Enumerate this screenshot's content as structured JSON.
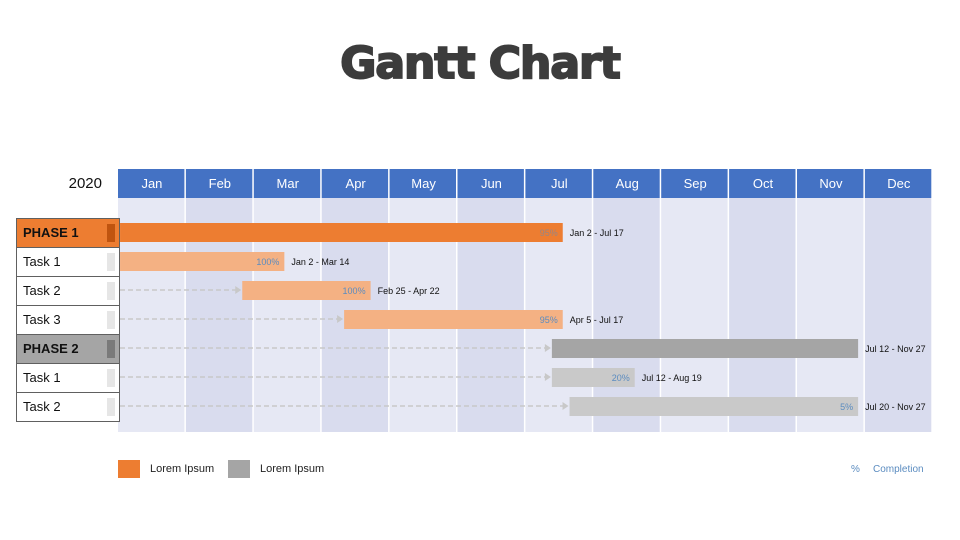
{
  "title": "Gantt Chart",
  "year": "2020",
  "colors": {
    "header": "#4472c4",
    "col_light": "#e6e8f4",
    "col_dark": "#d9dcee",
    "phase1": "#ed7d31",
    "phase1_task": "#f4b183",
    "phase2": "#a5a5a5",
    "phase2_task": "#c9c9c9",
    "percent_text": "#5b8cc0"
  },
  "legend": [
    {
      "label": "Lorem Ipsum",
      "color": "#ed7d31"
    },
    {
      "label": "Lorem Ipsum",
      "color": "#a5a5a5"
    }
  ],
  "footer": {
    "percent_symbol": "%",
    "completion_label": "Completion"
  },
  "chart_data": {
    "type": "gantt",
    "title": "Gantt Chart",
    "year": "2020",
    "categories": [
      "Jan",
      "Feb",
      "Mar",
      "Apr",
      "May",
      "Jun",
      "Jul",
      "Aug",
      "Sep",
      "Oct",
      "Nov",
      "Dec"
    ],
    "rows": [
      {
        "label": "PHASE 1",
        "kind": "phase1",
        "start": "Jan 2",
        "end": "Jul 17",
        "start_month": 0.03,
        "end_month": 6.55,
        "percent": "95%",
        "date_label": "Jan 2 - Jul 17"
      },
      {
        "label": "Task 1",
        "kind": "phase1_task",
        "start": "Jan 2",
        "end": "Mar 14",
        "start_month": 0.03,
        "end_month": 2.45,
        "percent": "100%",
        "date_label": "Jan 2 - Mar 14"
      },
      {
        "label": "Task 2",
        "kind": "phase1_task",
        "start": "Feb 25",
        "end": "Apr 22",
        "start_month": 1.83,
        "end_month": 3.72,
        "percent": "100%",
        "date_label": "Feb 25 - Apr 22"
      },
      {
        "label": "Task 3",
        "kind": "phase1_task",
        "start": "Apr 5",
        "end": "Jul 17",
        "start_month": 3.33,
        "end_month": 6.55,
        "percent": "95%",
        "date_label": "Apr 5 - Jul 17"
      },
      {
        "label": "PHASE 2",
        "kind": "phase2",
        "start": "Jul 12",
        "end": "Nov 27",
        "start_month": 6.39,
        "end_month": 10.9,
        "percent": "",
        "date_label": "Jul 12 - Nov 27"
      },
      {
        "label": "Task 1",
        "kind": "phase2_task",
        "start": "Jul 12",
        "end": "Aug 19",
        "start_month": 6.39,
        "end_month": 7.61,
        "percent": "20%",
        "date_label": "Jul 12 - Aug 19"
      },
      {
        "label": "Task 2",
        "kind": "phase2_task",
        "start": "Jul 20",
        "end": "Nov 27",
        "start_month": 6.65,
        "end_month": 10.9,
        "percent": "5%",
        "date_label": "Jul 20 - Nov 27"
      }
    ]
  }
}
